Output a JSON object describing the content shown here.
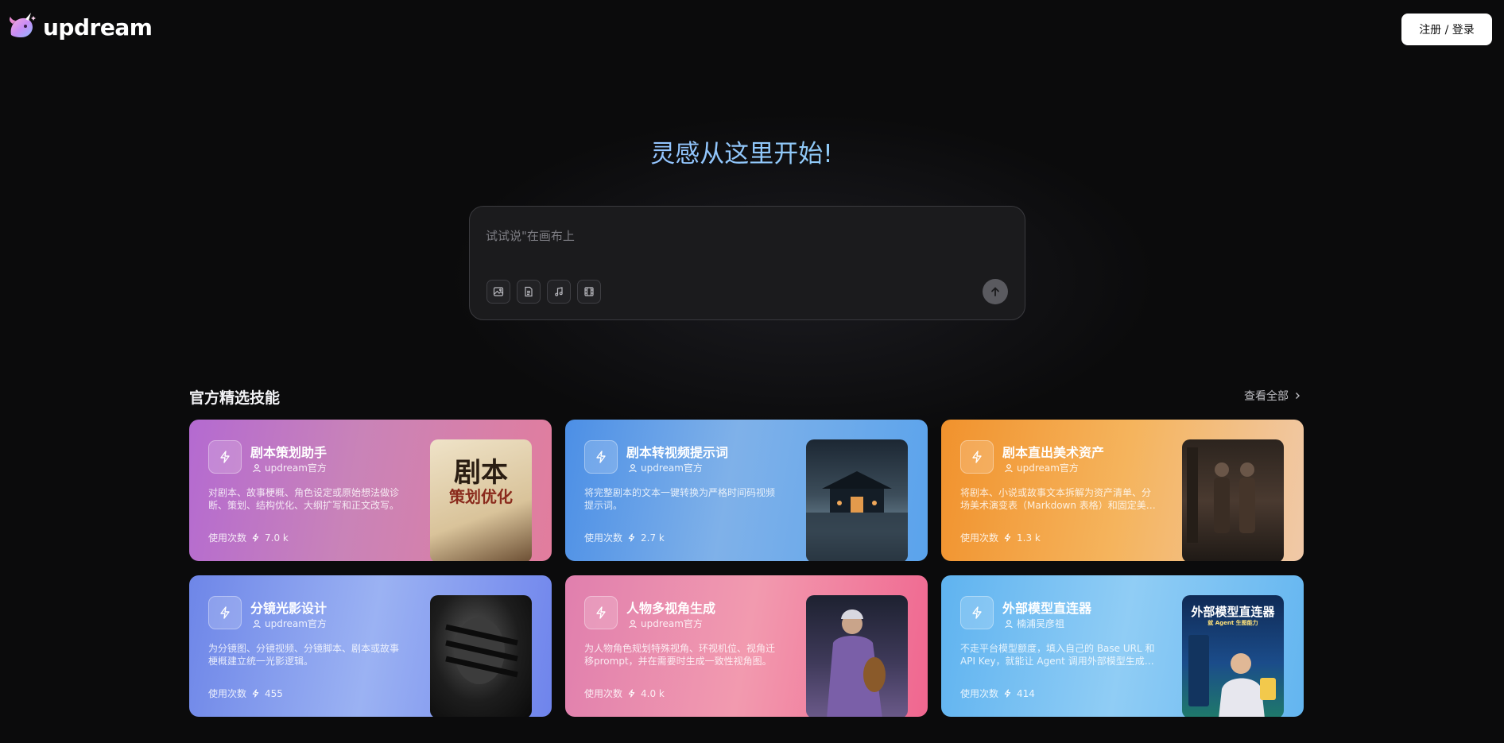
{
  "header": {
    "brand": "updream",
    "login_label": "注册 / 登录"
  },
  "hero": {
    "title": "灵感从这里开始!",
    "prompt_placeholder": "试试说\"在画布上",
    "tools": [
      "image-icon",
      "document-icon",
      "music-icon",
      "film-icon"
    ]
  },
  "section": {
    "title": "官方精选技能",
    "view_all": "查看全部"
  },
  "usage_label": "使用次数",
  "cards": [
    {
      "title": "剧本策划助手",
      "author": "updream官方",
      "description": "对剧本、故事梗概、角色设定或原始想法做诊断、策划、结构优化、大纲扩写和正文改写。",
      "usage": "7.0 k",
      "thumb_text_main": "剧本",
      "thumb_text_sub": "策划优化"
    },
    {
      "title": "剧本转视频提示词",
      "author": "updream官方",
      "description": "将完整剧本的文本一键转换为严格时间码视频提示词。",
      "usage": "2.7 k"
    },
    {
      "title": "剧本直出美术资产",
      "author": "updream官方",
      "description": "将剧本、小说或故事文本拆解为资产清单、分场美术演变表（Markdown 表格）和固定美学提示词。",
      "usage": "1.3 k"
    },
    {
      "title": "分镜光影设计",
      "author": "updream官方",
      "description": "为分镜图、分镜视频、分镜脚本、剧本或故事梗概建立统一光影逻辑。",
      "usage": "455"
    },
    {
      "title": "人物多视角生成",
      "author": "updream官方",
      "description": "为人物角色规划特殊视角、环视机位、视角迁移prompt，并在需要时生成一致性视角图。",
      "usage": "4.0 k"
    },
    {
      "title": "外部模型直连器",
      "author": "楠浦吴彦祖",
      "description": "不走平台模型额度，填入自己的 Base URL 和 API Key，就能让 Agent 调用外部模型生成图片。",
      "usage": "414",
      "thumb_text_main": "外部模型直连器",
      "thumb_text_sub": "就 Agent 生图能力"
    }
  ]
}
